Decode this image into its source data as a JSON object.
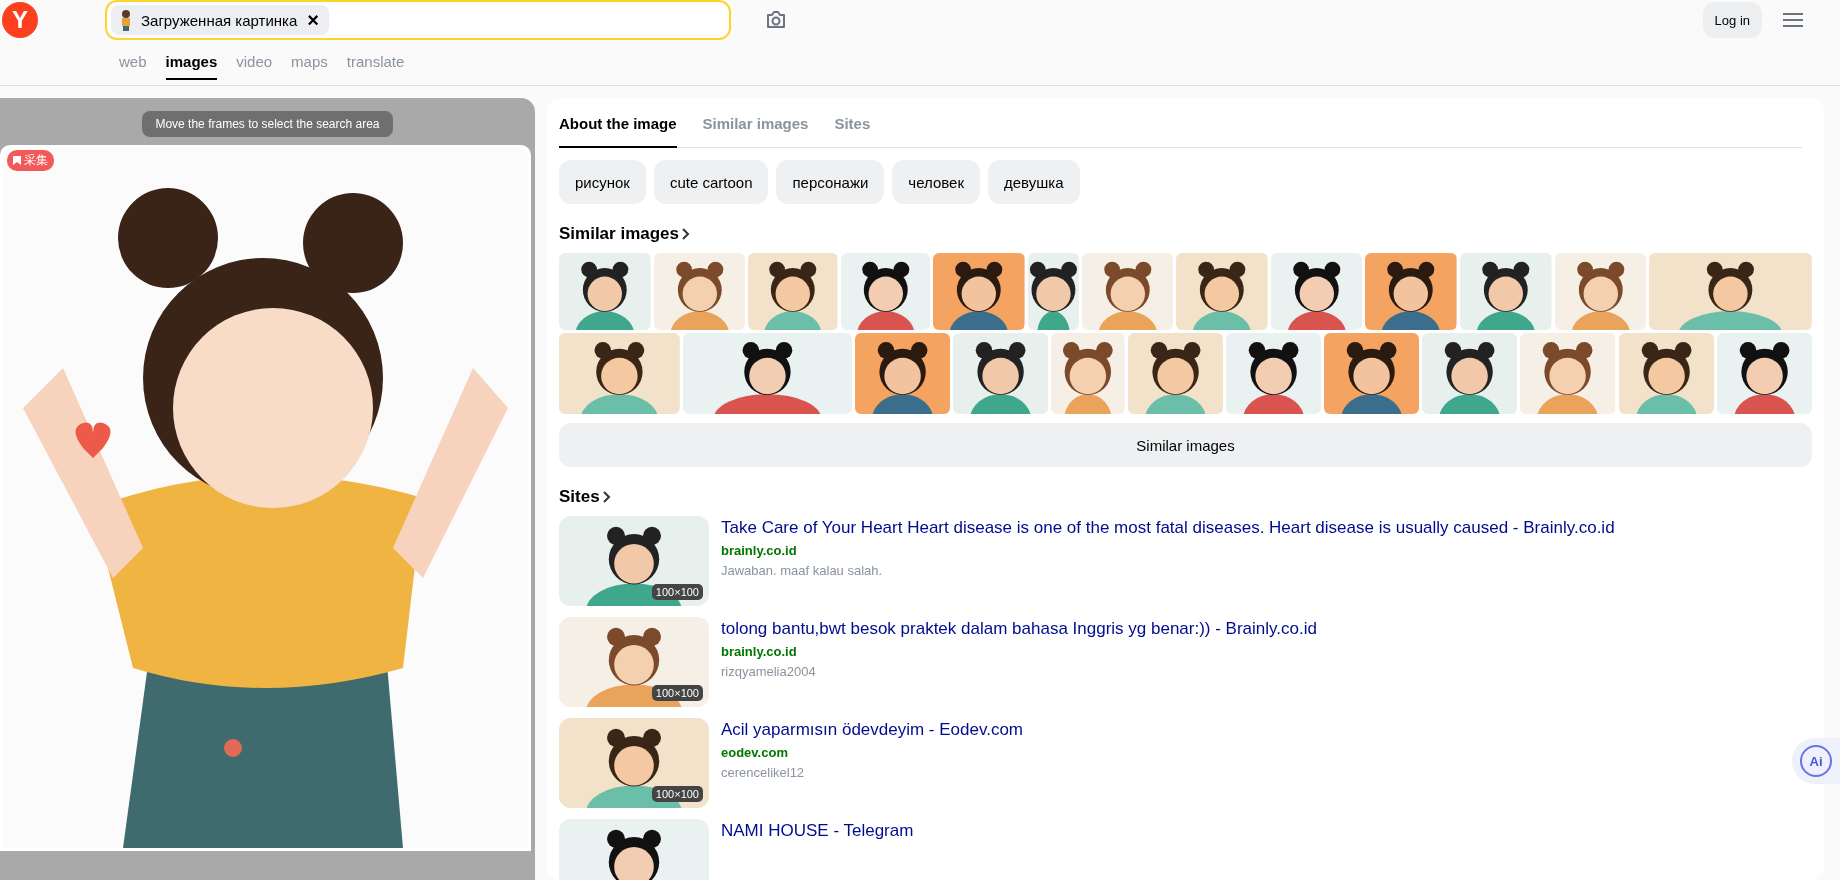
{
  "header": {
    "logo": "Y",
    "search": {
      "chip": "Загруженная картинка",
      "remove": "×"
    },
    "login": "Log in"
  },
  "nav": [
    {
      "label": "web",
      "selected": false
    },
    {
      "label": "images",
      "selected": true
    },
    {
      "label": "video",
      "selected": false
    },
    {
      "label": "maps",
      "selected": false
    },
    {
      "label": "translate",
      "selected": false
    }
  ],
  "viewer": {
    "hint": "Move the frames to select the search area",
    "badge": "采集"
  },
  "tabs": [
    {
      "label": "About the image",
      "selected": true
    },
    {
      "label": "Similar images",
      "selected": false
    },
    {
      "label": "Sites",
      "selected": false
    }
  ],
  "tags": [
    "рисунок",
    "cute cartoon",
    "персонажи",
    "человек",
    "девушка"
  ],
  "similar": {
    "title": "Similar images",
    "more": "Similar images"
  },
  "sites": {
    "title": "Sites",
    "items": [
      {
        "size": "100×100",
        "title": "Take Care of Your Heart Heart disease is one of the most fatal diseases. Heart disease is usually caused - Brainly.co.id",
        "domain": "brainly.co.id",
        "snippet": "Jawaban. maaf kalau salah."
      },
      {
        "size": "100×100",
        "title": "tolong bantu,bwt besok praktek dalam bahasa Inggris yg benar:)) - Brainly.co.id",
        "domain": "brainly.co.id",
        "snippet": "rizqyamelia2004"
      },
      {
        "size": "100×100",
        "title": "Acil yaparmısın ödevdeyim - Eodev.com",
        "domain": "eodev.com",
        "snippet": "cerencelikel12"
      },
      {
        "title": "NAMI HOUSE - Telegram"
      }
    ]
  },
  "ai_button": "Ai"
}
